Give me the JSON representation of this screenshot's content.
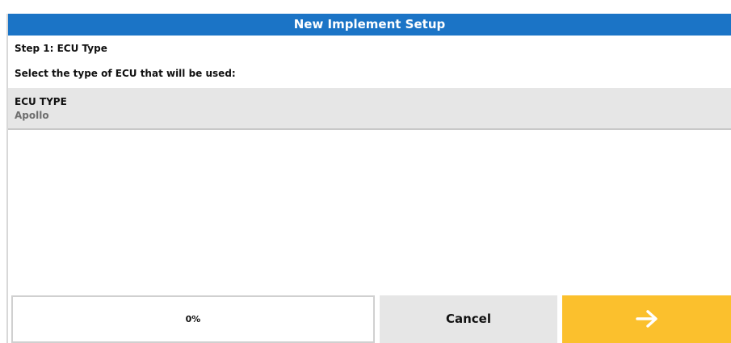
{
  "window": {
    "title": "New Implement Setup"
  },
  "wizard": {
    "step_label": "Step 1: ECU Type",
    "instruction": "Select the type of ECU that will be used:",
    "fields": [
      {
        "label": "ECU TYPE",
        "value": "Apollo"
      }
    ]
  },
  "footer": {
    "progress_percent": 0,
    "progress_text": "0%",
    "cancel_label": "Cancel",
    "next_icon": "arrow-right-icon"
  },
  "colors": {
    "title_bar": "#1b74c6",
    "next_button": "#fbc02d",
    "row_background": "#e6e6e6"
  }
}
